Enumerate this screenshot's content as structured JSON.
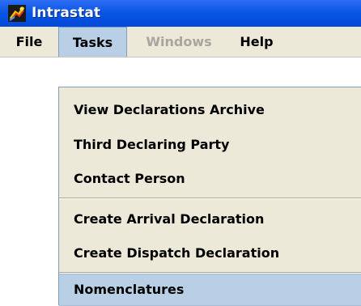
{
  "window": {
    "title": "Intrastat",
    "icon": "intrastat-app-icon"
  },
  "menubar": {
    "items": [
      {
        "label": "File",
        "state": "normal"
      },
      {
        "label": "Tasks",
        "state": "open"
      },
      {
        "label": "Windows",
        "state": "disabled"
      },
      {
        "label": "Help",
        "state": "normal"
      }
    ]
  },
  "tasks_menu": {
    "items": [
      {
        "label": "View Declarations Archive"
      },
      {
        "label": "Third Declaring Party"
      },
      {
        "label": "Contact Person"
      },
      {
        "label": "Create Arrival Declaration"
      },
      {
        "label": "Create Dispatch Declaration"
      },
      {
        "label": "Nomenclatures",
        "highlighted": true
      }
    ]
  },
  "colors": {
    "titlebar": "#0a57e4",
    "menubar": "#ece9d8",
    "selection": "#b8cfe5",
    "disabled_text": "#a7a6a0"
  }
}
